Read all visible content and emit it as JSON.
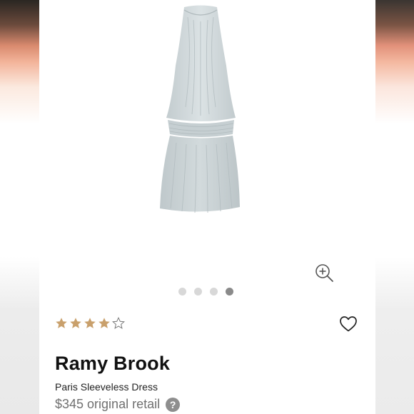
{
  "product": {
    "brand": "Ramy Brook",
    "model": "Paris Sleeveless Dress",
    "price_text": "$345 original retail",
    "rating": 4,
    "rating_max": 5,
    "image_count": 4,
    "active_image_index": 3
  },
  "icons": {
    "zoom": "zoom-in-icon",
    "favorite": "heart-outline-icon",
    "help": "question-circle-icon",
    "help_glyph": "?"
  },
  "colors": {
    "star_filled": "#c9a06c",
    "star_empty": "#777777",
    "dress": "#cfd7da",
    "dot_active": "#8a8a8a",
    "dot_inactive": "#d8d8d8"
  }
}
